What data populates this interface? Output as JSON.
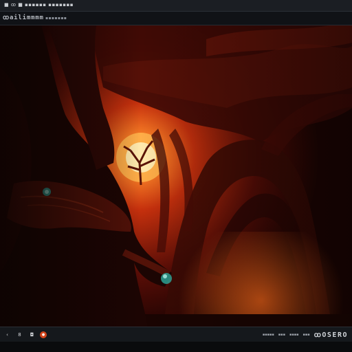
{
  "window": {
    "title": "■ ꝏ ■ ▪▪▪▪▪▪ ▪▪▪▪▪▪▪",
    "toolbar_label": "ꝏailimmmm",
    "toolbar_sub": "▪▪▪▪▪▪▪"
  },
  "viewport": {
    "scene": "render"
  },
  "status": {
    "left_buttons": [
      {
        "icon": "prev-icon",
        "glyph": "‹"
      },
      {
        "icon": "frame-icon",
        "glyph": "8"
      },
      {
        "icon": "camera-icon",
        "glyph": "◘"
      },
      {
        "icon": "record-icon",
        "glyph": "●"
      }
    ],
    "small_text_1": "▪▪▪▪▪",
    "small_text_2": "▪▪▪",
    "small_text_3": "▪▪▪▪",
    "small_text_4": "▪▪▪",
    "right_label": "ꝏOSERO"
  },
  "colors": {
    "sky_glow": "#ff6a1a",
    "deep_red": "#3a0804",
    "accent_teal": "#2fb4a6"
  }
}
